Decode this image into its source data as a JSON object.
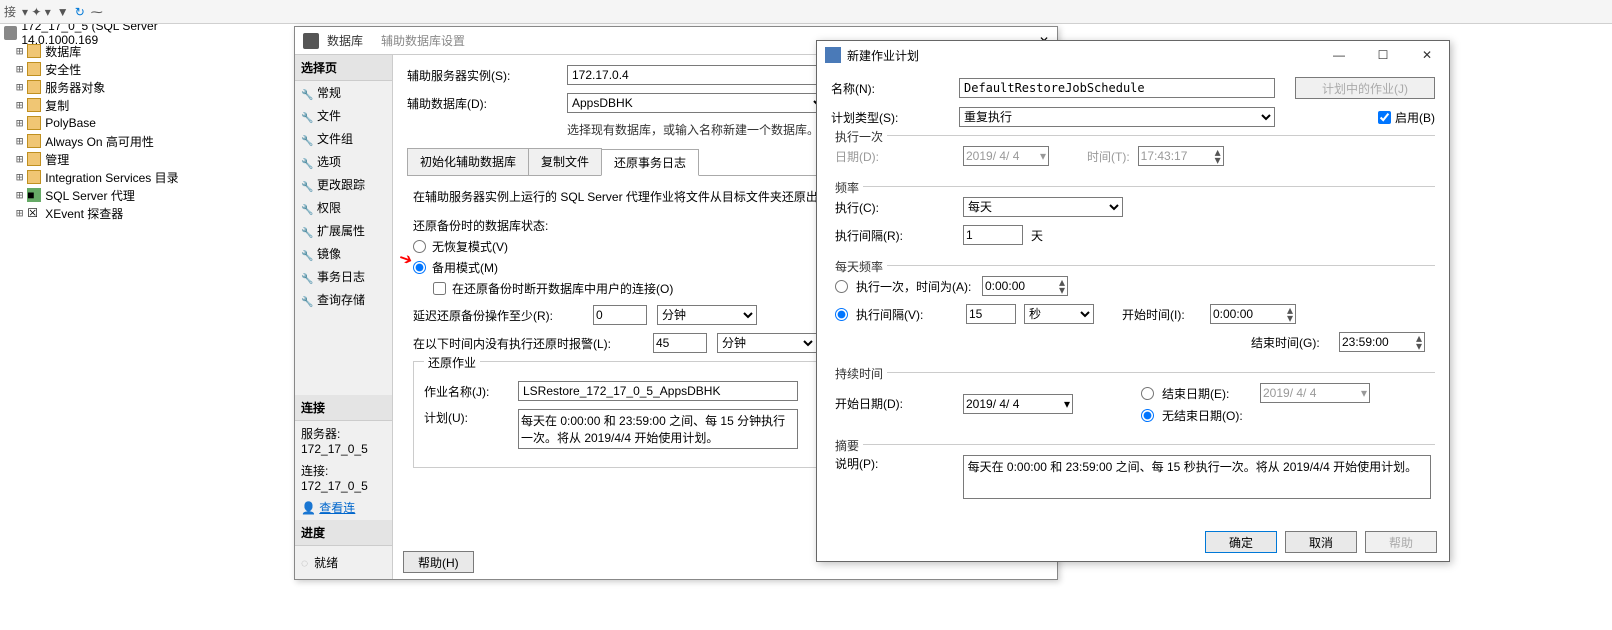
{
  "toolbar": {
    "connect": "接",
    "sep": "▾"
  },
  "tree": {
    "root": "172_17_0_5 (SQL Server 14.0.1000.169",
    "items": [
      "数据库",
      "安全性",
      "服务器对象",
      "复制",
      "PolyBase",
      "Always On 高可用性",
      "管理",
      "Integration Services 目录"
    ],
    "agent": "SQL Server 代理",
    "xevent": "XEvent 探查器"
  },
  "dlg1": {
    "title1": "数据库",
    "title2": "辅助数据库设置",
    "sections": {
      "select": "选择页",
      "items": [
        "常规",
        "文件",
        "文件组",
        "选项",
        "更改跟踪",
        "权限",
        "扩展属性",
        "镜像",
        "事务日志",
        "查询存储"
      ],
      "conn": "连接",
      "server_lbl": "服务器:",
      "server_val": "172_17_0_5",
      "conn_lbl": "连接:",
      "conn_val": "172_17_0_5",
      "viewconn": "查看连",
      "progress": "进度",
      "ready": "就绪"
    },
    "right": {
      "sec_server_lbl": "辅助服务器实例(S):",
      "sec_server_val": "172.17.0.4",
      "sec_db_lbl": "辅助数据库(D):",
      "sec_db_val": "AppsDBHK",
      "hint": "选择现有数据库，或输入名称新建一个数据库。",
      "tabs": [
        "初始化辅助数据库",
        "复制文件",
        "还原事务日志"
      ],
      "desc": "在辅助服务器实例上运行的 SQL Server 代理作业将文件从目标文件夹还原出来。",
      "state_lbl": "还原备份时的数据库状态:",
      "radio1": "无恢复模式(V)",
      "radio2": "备用模式(M)",
      "chk": "在还原备份时断开数据库中用户的连接(O)",
      "delay_lbl": "延迟还原备份操作至少(R):",
      "delay_val": "0",
      "unit": "分钟",
      "alert_lbl": "在以下时间内没有执行还原时报警(L):",
      "alert_val": "45",
      "job_grp": "还原作业",
      "job_lbl": "作业名称(J):",
      "job_val": "LSRestore_172_17_0_5_AppsDBHK",
      "sched_lbl": "计划(U):",
      "sched_val": "每天在 0:00:00 和 23:59:00 之间、每 15 分钟执行一次。将从 2019/4/4 开始使用计划。",
      "help": "帮助(H)"
    }
  },
  "dlg2": {
    "title": "新建作业计划",
    "name_lbl": "名称(N):",
    "name_val": "DefaultRestoreJobSchedule",
    "jobs_btn": "计划中的作业(J)",
    "type_lbl": "计划类型(S):",
    "type_val": "重复执行",
    "enable_lbl": "启用(B)",
    "once_grp": "执行一次",
    "date_lbl": "日期(D):",
    "date_val": "2019/ 4/ 4",
    "time_lbl": "时间(T):",
    "time_val": "17:43:17",
    "freq_grp": "频率",
    "exec_lbl": "执行(C):",
    "exec_val": "每天",
    "interval_lbl": "执行间隔(R):",
    "interval_val": "1",
    "interval_unit": "天",
    "daily_grp": "每天频率",
    "once_radio": "执行一次，时间为(A):",
    "once_time": "0:00:00",
    "repeat_radio": "执行间隔(V):",
    "repeat_val": "15",
    "repeat_unit": "秒",
    "start_lbl": "开始时间(I):",
    "start_val": "0:00:00",
    "end_lbl": "结束时间(G):",
    "end_val": "23:59:00",
    "dur_grp": "持续时间",
    "startdate_lbl": "开始日期(D):",
    "startdate_val": "2019/ 4/ 4",
    "enddate_radio": "结束日期(E):",
    "enddate_val": "2019/ 4/ 4",
    "noend_radio": "无结束日期(O):",
    "sum_grp": "摘要",
    "desc_lbl": "说明(P):",
    "desc_val": "每天在 0:00:00 和 23:59:00 之间、每 15 秒执行一次。将从 2019/4/4 开始使用计划。",
    "ok": "确定",
    "cancel": "取消",
    "help": "帮助"
  }
}
